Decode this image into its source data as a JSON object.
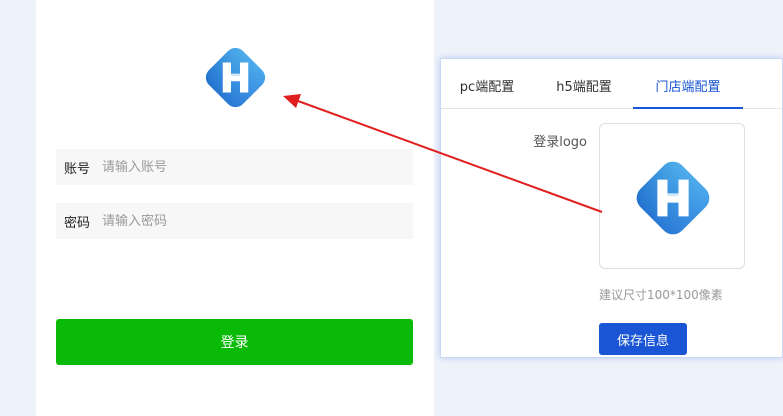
{
  "login_preview": {
    "logo_icon": "h-brand-logo-icon",
    "account_label": "账号",
    "account_placeholder": "请输入账号",
    "password_label": "密码",
    "password_placeholder": "请输入密码",
    "submit_label": "登录",
    "submit_color": "#09bb07"
  },
  "settings": {
    "tabs": [
      {
        "label": "pc端配置",
        "active": false
      },
      {
        "label": "h5端配置",
        "active": false
      },
      {
        "label": "门店端配置",
        "active": true
      }
    ],
    "logo_label": "登录logo",
    "logo_icon": "h-brand-logo-icon",
    "size_hint": "建议尺寸100*100像素",
    "save_label": "保存信息",
    "accent_color": "#1955d4"
  },
  "annotation": {
    "arrow_color": "#e02020"
  },
  "colors": {
    "page_background": "#eef2fa",
    "logo_light_blue": "#4fb4ee",
    "logo_dark_blue": "#1a6fd6"
  }
}
